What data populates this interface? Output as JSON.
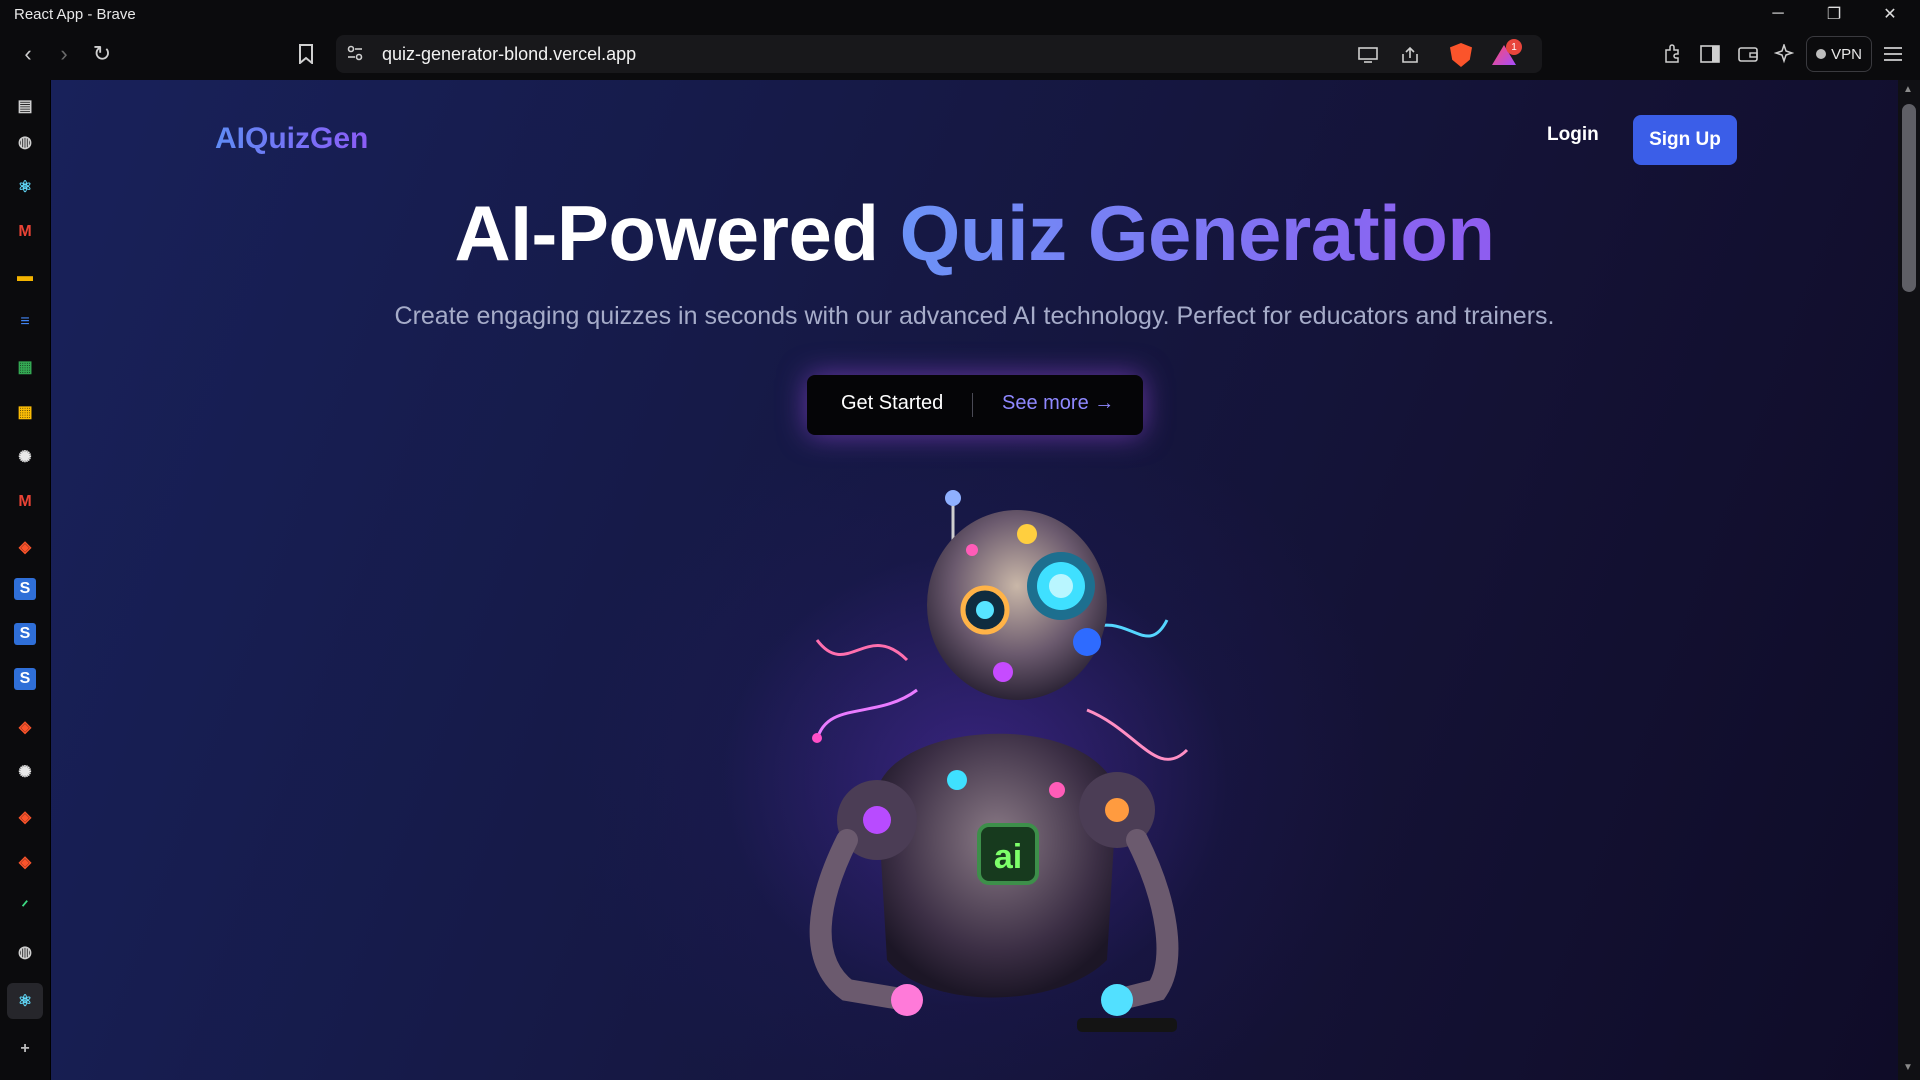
{
  "window": {
    "title": "React App - Brave",
    "controls": {
      "minimize": "─",
      "maximize": "❐",
      "close": "✕"
    }
  },
  "browser": {
    "url": "quiz-generator-blond.vercel.app",
    "nav": {
      "back": "‹",
      "forward": "›",
      "reload": "↻",
      "bookmark": "🔖"
    },
    "notification_count": "1",
    "vpn_label": "VPN",
    "brand_color": "#fb542b"
  },
  "sidebar": {
    "items": [
      {
        "icon": "sidebar-panel-icon",
        "glyph": "▤"
      },
      {
        "icon": "globe-icon",
        "glyph": "◍"
      },
      {
        "icon": "react-icon",
        "glyph": "⚛"
      },
      {
        "icon": "gmail-icon",
        "glyph": "M"
      },
      {
        "icon": "slides-icon",
        "glyph": "▬"
      },
      {
        "icon": "docs-icon",
        "glyph": "≡"
      },
      {
        "icon": "photos-icon",
        "glyph": "▦"
      },
      {
        "icon": "photos-icon-2",
        "glyph": "▦"
      },
      {
        "icon": "openai-icon",
        "glyph": "✺"
      },
      {
        "icon": "gmail-icon-2",
        "glyph": "M"
      },
      {
        "icon": "brave-shield-icon",
        "glyph": "◈"
      },
      {
        "icon": "s-app-icon",
        "glyph": "S"
      },
      {
        "icon": "s-app-icon-2",
        "glyph": "S"
      },
      {
        "icon": "s-app-icon-3",
        "glyph": "S"
      },
      {
        "icon": "brave-shield-icon-2",
        "glyph": "◈"
      },
      {
        "icon": "openai-icon-2",
        "glyph": "✺"
      },
      {
        "icon": "brave-shield-icon-3",
        "glyph": "◈"
      },
      {
        "icon": "brave-shield-icon-4",
        "glyph": "◈"
      },
      {
        "icon": "leaf-icon",
        "glyph": "ᐟ"
      },
      {
        "icon": "globe-icon-2",
        "glyph": "◍"
      },
      {
        "icon": "react-icon-active",
        "glyph": "⚛"
      },
      {
        "icon": "add-icon",
        "glyph": "+"
      }
    ]
  },
  "page": {
    "logo": "AIQuizGen",
    "nav": {
      "login": "Login",
      "signup": "Sign Up"
    },
    "hero": {
      "title_plain": "AI-Powered",
      "title_accent": "Quiz Generation",
      "subtitle": "Create engaging quizzes in seconds with our advanced AI technology. Perfect for educators and trainers."
    },
    "cta": {
      "primary": "Get Started",
      "secondary": "See more →"
    },
    "robot_badge": "ai",
    "colors": {
      "accent_blue": "#3b5ee8",
      "gradient_start": "#6c93f7",
      "gradient_end": "#8f5cf0",
      "link_violet": "#8f88ff"
    }
  }
}
